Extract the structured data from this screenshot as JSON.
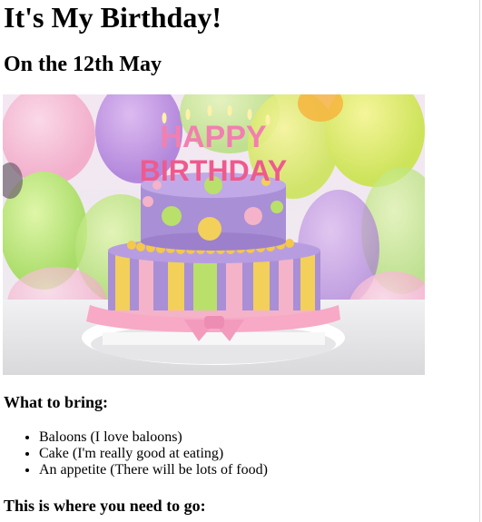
{
  "page": {
    "title": "It's My Birthday!",
    "subtitle": "On the 12th May"
  },
  "hero_image": {
    "cake_top_text": "HAPPY",
    "cake_bottom_text": "BIRTHDAY"
  },
  "bring_section": {
    "heading": "What to bring:",
    "items": [
      "Baloons (I love baloons)",
      "Cake (I'm really good at eating)",
      "An appetite (There will be lots of food)"
    ]
  },
  "directions_section": {
    "heading": "This is where you need to go:"
  },
  "colors": {
    "background": "#ffffff",
    "text": "#000000",
    "cake_purple": "#a98fd6",
    "cake_pink": "#f5b3c9",
    "cake_yellow": "#f2d05a"
  }
}
